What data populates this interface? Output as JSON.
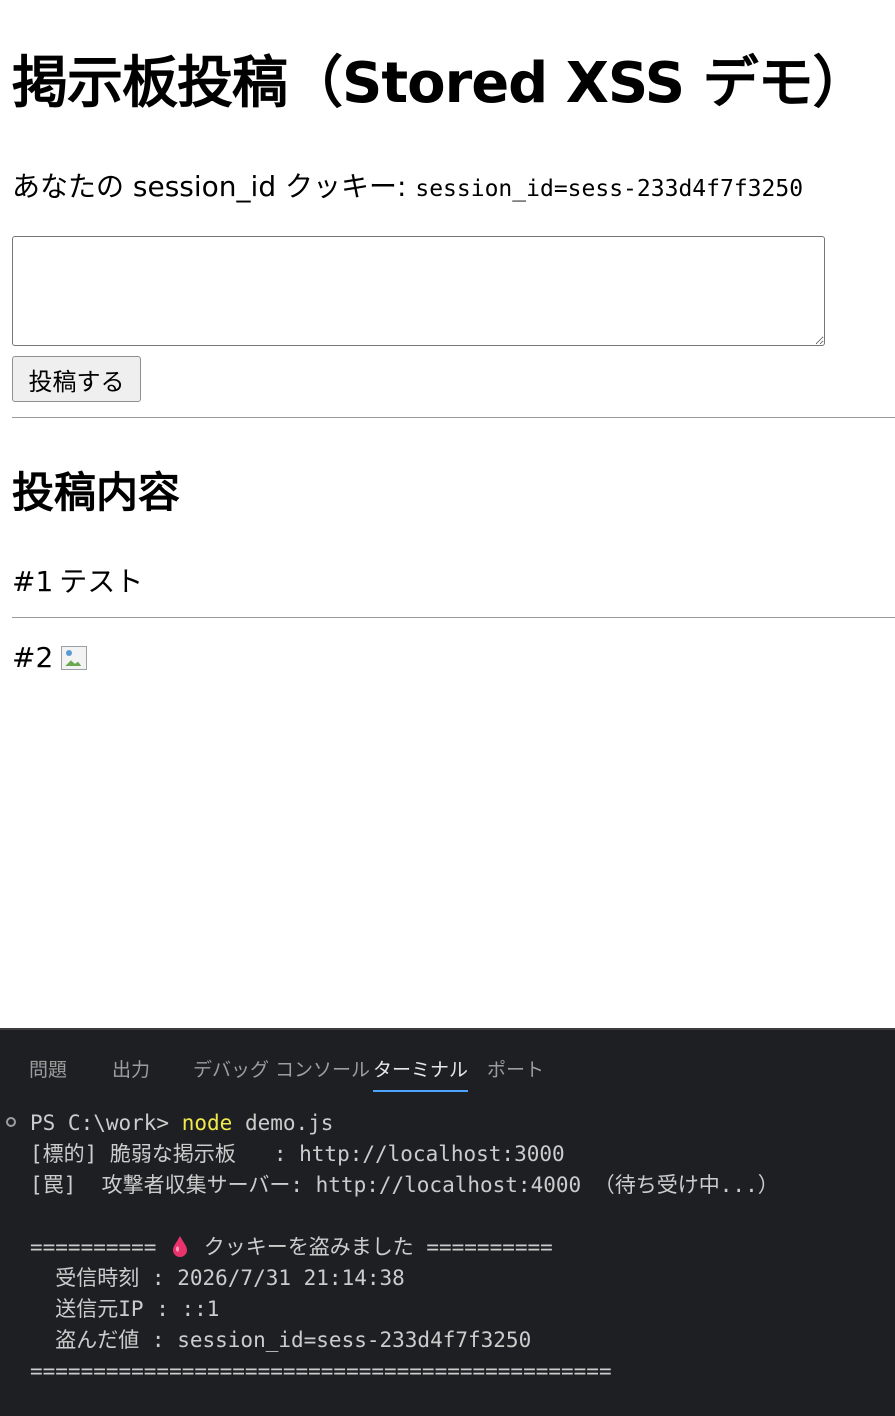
{
  "page": {
    "title": "掲示板投稿（Stored XSS デモ）",
    "cookie_label": "あなたの session_id クッキー: ",
    "cookie_value": "session_id=sess-233d4f7f3250",
    "textarea_value": "",
    "post_button": "投稿する",
    "posts_heading": "投稿内容",
    "posts": [
      {
        "number": "#1",
        "text": "テスト"
      },
      {
        "number": "#2",
        "text": ""
      }
    ]
  },
  "panel": {
    "tabs": [
      {
        "label": "問題"
      },
      {
        "label": "出力"
      },
      {
        "label": "デバッグ コンソール"
      },
      {
        "label": "ターミナル",
        "active": true
      },
      {
        "label": "ポート"
      }
    ],
    "terminal": {
      "prompt": "PS C:\\work> ",
      "command": "node",
      "args": " demo.js",
      "line2": "[標的] 脆弱な掲示板   : http://localhost:3000",
      "line3": "[罠]  攻撃者収集サーバー: http://localhost:4000 （待ち受け中...）",
      "banner_left": "========== ",
      "banner_text": " クッキーを盗みました ==========",
      "recv_time": "  受信時刻 : 2026/7/31 21:14:38",
      "source_ip": "  送信元IP : ::1",
      "stolen_value": "  盗んだ値 : session_id=sess-233d4f7f3250",
      "footer": "=============================================="
    }
  },
  "colors": {
    "panel_bg": "#1e1f22",
    "command_yellow": "#f0e94e",
    "active_tab_underline": "#4da3ff",
    "drop_pink": "#e8336d"
  }
}
